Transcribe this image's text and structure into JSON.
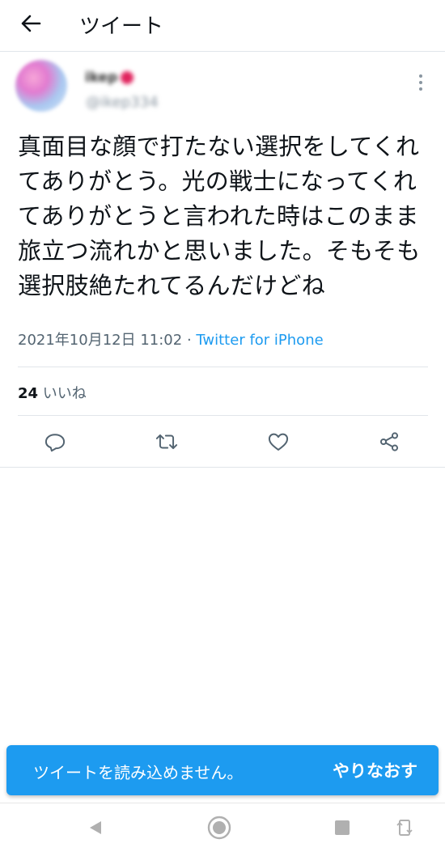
{
  "header": {
    "title": "ツイート"
  },
  "tweet": {
    "user_name": "ikep",
    "user_handle": "@ikep334",
    "text": "真面目な顔で打たない選択をしてくれてありがとう。光の戦士になってくれてありがとうと言われた時はこのまま旅立つ流れかと思いました。そもそも選択肢絶たれてるんだけどね",
    "timestamp": "2021年10月12日 11:02",
    "separator": " · ",
    "source": "Twitter for iPhone",
    "likes_count": "24",
    "likes_label": "いいね"
  },
  "toast": {
    "message": "ツイートを読み込めません。",
    "retry_label": "やりなおす"
  },
  "colors": {
    "accent": "#1d9bf0",
    "text": "#0f1419",
    "secondary": "#536471"
  },
  "icons": [
    "back-arrow-icon",
    "more-vertical-icon",
    "reply-icon",
    "retweet-icon",
    "like-icon",
    "share-icon",
    "nav-back-icon",
    "nav-home-icon",
    "nav-recents-icon",
    "nav-rotate-icon"
  ]
}
